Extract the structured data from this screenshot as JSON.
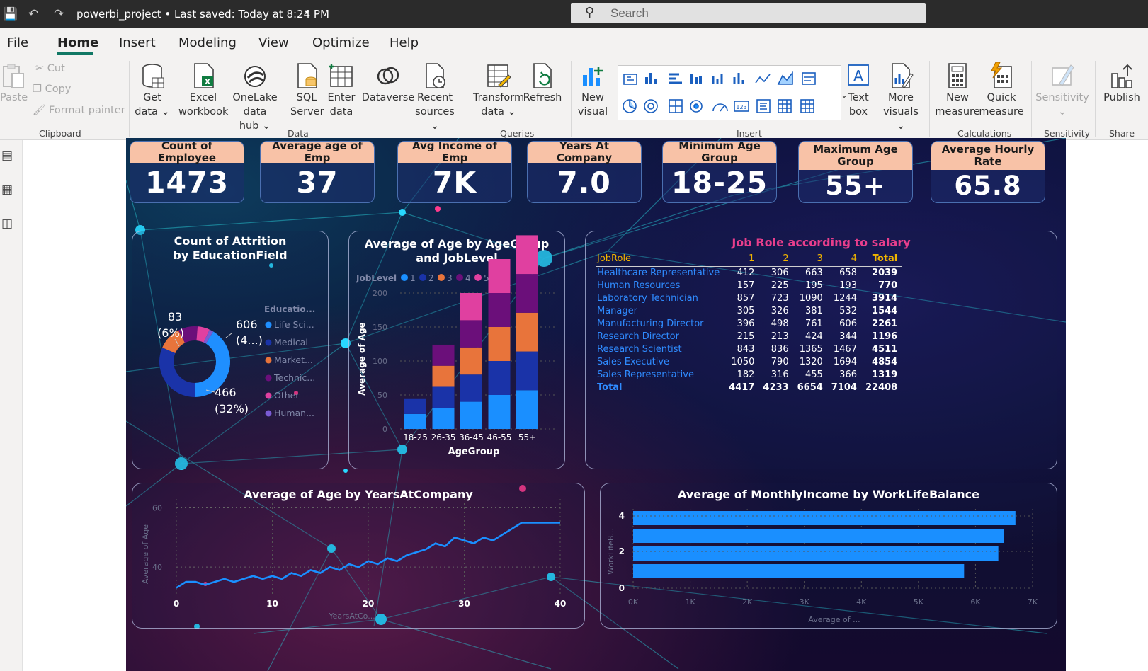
{
  "titlebar": {
    "title": "powerbi_project • Last saved: Today at 8:24 PM",
    "search_placeholder": "Search"
  },
  "menu": {
    "tabs": [
      "File",
      "Home",
      "Insert",
      "Modeling",
      "View",
      "Optimize",
      "Help"
    ],
    "active": "Home"
  },
  "ribbon": {
    "clipboard": {
      "paste": "Paste",
      "cut": "Cut",
      "copy": "Copy",
      "format_painter": "Format painter",
      "group": "Clipboard"
    },
    "data": {
      "get_data": [
        "Get",
        "data ⌄"
      ],
      "excel": [
        "Excel",
        "workbook"
      ],
      "onelake": [
        "OneLake data",
        "hub ⌄"
      ],
      "sql": [
        "SQL",
        "Server"
      ],
      "enter": [
        "Enter",
        "data"
      ],
      "dataverse": [
        "Dataverse"
      ],
      "recent": [
        "Recent",
        "sources ⌄"
      ],
      "group": "Data"
    },
    "queries": {
      "transform": [
        "Transform",
        "data ⌄"
      ],
      "refresh": [
        "Refresh"
      ],
      "group": "Queries"
    },
    "insert": {
      "new_visual": [
        "New",
        "visual"
      ],
      "text_box": [
        "Text",
        "box"
      ],
      "more_visuals": [
        "More",
        "visuals ⌄"
      ],
      "group": "Insert"
    },
    "calculations": {
      "new_measure": [
        "New",
        "measure"
      ],
      "quick_measure": [
        "Quick",
        "measure"
      ],
      "group": "Calculations"
    },
    "sensitivity": {
      "label": [
        "Sensitivity",
        "⌄"
      ],
      "group": "Sensitivity"
    },
    "share": {
      "publish": [
        "Publish"
      ],
      "group": "Share"
    }
  },
  "kpis": [
    {
      "label": "Count of Employee",
      "value": "1473"
    },
    {
      "label": "Average age of Emp",
      "value": "37"
    },
    {
      "label": "Avg Income of Emp",
      "value": "7K"
    },
    {
      "label": "Years At Company",
      "value": "7.0"
    },
    {
      "label": "Minimum Age Group",
      "value": "18-25"
    },
    {
      "label": "Maximum Age Group",
      "value": "55+"
    },
    {
      "label": "Average Hourly Rate",
      "value": "65.8"
    }
  ],
  "donut": {
    "title": "Count of Attrition by EducationField",
    "legend_title": "Educatio...",
    "legend": [
      "Life Sci...",
      "Medical",
      "Market...",
      "Technic...",
      "Other",
      "Human..."
    ],
    "colors": {
      "Life Sciences": "#1f8fff",
      "Medical": "#1a33a8",
      "Marketing": "#e8743b",
      "Technical": "#6b0f7a",
      "Other": "#e040a0",
      "Human": "#7a5bd4"
    },
    "labels": {
      "top": [
        "83",
        "(6%)"
      ],
      "right": [
        "606",
        "(4...)"
      ],
      "bottom": [
        "466",
        "(32%)"
      ]
    },
    "chart_data": {
      "type": "pie",
      "categories": [
        "Life Sciences",
        "Medical",
        "Marketing",
        "Technical",
        "Other",
        "Human"
      ],
      "values": [
        606,
        466,
        159,
        132,
        82,
        28
      ]
    }
  },
  "agebar": {
    "title": "Average of Age by AgeGroup and JobLevel",
    "legend_title": "JobLevel",
    "legend": [
      "1",
      "2",
      "3",
      "4",
      "5"
    ],
    "colors": [
      "#1a8fff",
      "#1a33a8",
      "#e8743b",
      "#6b0f7a",
      "#e040a0"
    ],
    "xlabel": "AgeGroup",
    "ylabel": "Average of Age",
    "yticks": [
      "0",
      "50",
      "100",
      "150",
      "200"
    ],
    "chart_data": {
      "type": "bar",
      "stacked": true,
      "categories": [
        "18-25",
        "26-35",
        "36-45",
        "46-55",
        "55+"
      ],
      "series": [
        {
          "name": "1",
          "values": [
            22,
            31,
            40,
            50,
            57
          ]
        },
        {
          "name": "2",
          "values": [
            22,
            31,
            40,
            50,
            57
          ]
        },
        {
          "name": "3",
          "values": [
            0,
            31,
            40,
            50,
            57
          ]
        },
        {
          "name": "4",
          "values": [
            0,
            31,
            40,
            50,
            57
          ]
        },
        {
          "name": "5",
          "values": [
            0,
            0,
            40,
            50,
            57
          ]
        }
      ],
      "ylim": [
        0,
        200
      ]
    }
  },
  "jobrole": {
    "title": "Job Role according to salary",
    "headers": [
      "JobRole",
      "1",
      "2",
      "3",
      "4",
      "Total"
    ],
    "rows": [
      [
        "Healthcare Representative",
        "412",
        "306",
        "663",
        "658",
        "2039"
      ],
      [
        "Human Resources",
        "157",
        "225",
        "195",
        "193",
        "770"
      ],
      [
        "Laboratory Technician",
        "857",
        "723",
        "1090",
        "1244",
        "3914"
      ],
      [
        "Manager",
        "305",
        "326",
        "381",
        "532",
        "1544"
      ],
      [
        "Manufacturing Director",
        "396",
        "498",
        "761",
        "606",
        "2261"
      ],
      [
        "Research Director",
        "215",
        "213",
        "424",
        "344",
        "1196"
      ],
      [
        "Research Scientist",
        "843",
        "836",
        "1365",
        "1467",
        "4511"
      ],
      [
        "Sales Executive",
        "1050",
        "790",
        "1320",
        "1694",
        "4854"
      ],
      [
        "Sales Representative",
        "182",
        "316",
        "455",
        "366",
        "1319"
      ]
    ],
    "total": [
      "Total",
      "4417",
      "4233",
      "6654",
      "7104",
      "22408"
    ]
  },
  "line": {
    "title": "Average of Age by YearsAtCompany",
    "xlabel": "YearsAtCo...",
    "ylabel": "Average of Age",
    "xticks": [
      "0",
      "10",
      "20",
      "30",
      "40"
    ],
    "yticks": [
      "40",
      "60"
    ],
    "color": "#1a8fff",
    "chart_data": {
      "type": "line",
      "x": [
        0,
        1,
        2,
        3,
        4,
        5,
        6,
        7,
        8,
        9,
        10,
        11,
        12,
        13,
        14,
        15,
        16,
        17,
        18,
        19,
        20,
        21,
        22,
        23,
        24,
        25,
        26,
        27,
        28,
        29,
        30,
        31,
        32,
        33,
        34,
        35,
        36,
        37,
        38,
        39,
        40
      ],
      "y": [
        33,
        35,
        35,
        34,
        35,
        36,
        35,
        36,
        37,
        36,
        37,
        36,
        38,
        37,
        39,
        38,
        40,
        39,
        41,
        40,
        42,
        41,
        43,
        42,
        44,
        45,
        46,
        48,
        47,
        50,
        49,
        48,
        50,
        49,
        51,
        53,
        55,
        55,
        55,
        55,
        55
      ],
      "xlim": [
        0,
        40
      ],
      "ylim": [
        30,
        63
      ]
    }
  },
  "hbar": {
    "title": "Average of MonthlyIncome by WorkLifeBalance",
    "xlabel": "Average of ...",
    "ylabel": "WorkLifeB...",
    "xticks": [
      "0K",
      "1K",
      "2K",
      "3K",
      "4K",
      "5K",
      "6K",
      "7K"
    ],
    "yticks": [
      "0",
      "2",
      "4"
    ],
    "color": "#1a8fff",
    "chart_data": {
      "type": "bar",
      "orientation": "horizontal",
      "categories": [
        "1",
        "2",
        "3",
        "4"
      ],
      "values": [
        5800,
        6400,
        6500,
        6700
      ],
      "xlim": [
        0,
        7000
      ]
    }
  }
}
